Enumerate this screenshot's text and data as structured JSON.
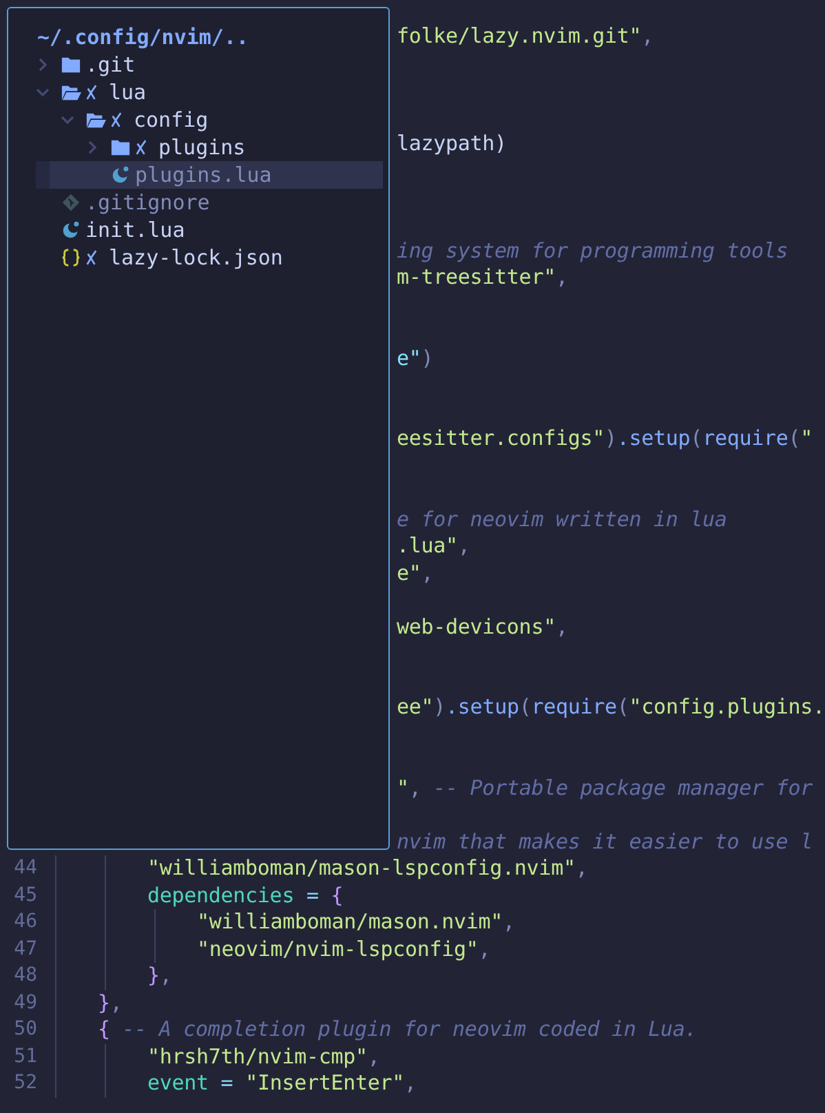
{
  "editor": {
    "rows": [
      {
        "kind": "partial",
        "segments": []
      },
      {
        "kind": "partial",
        "segments": [
          {
            "text": "folke/lazy.nvim.git\"",
            "kind": "str"
          },
          {
            "text": ",",
            "kind": "punct"
          }
        ]
      },
      {
        "kind": "partial",
        "segments": []
      },
      {
        "kind": "partial",
        "segments": []
      },
      {
        "kind": "partial",
        "segments": []
      },
      {
        "kind": "partial",
        "segments": [
          {
            "text": "lazypath)",
            "kind": "plain"
          }
        ]
      },
      {
        "kind": "partial",
        "segments": []
      },
      {
        "kind": "partial",
        "segments": []
      },
      {
        "kind": "partial",
        "segments": []
      },
      {
        "kind": "partial",
        "segments": [
          {
            "text": "ing system for programming tools",
            "kind": "comment"
          }
        ]
      },
      {
        "kind": "partial",
        "segments": [
          {
            "text": "m-treesitter\"",
            "kind": "str"
          },
          {
            "text": ",",
            "kind": "punct"
          }
        ]
      },
      {
        "kind": "partial",
        "segments": []
      },
      {
        "kind": "partial",
        "segments": []
      },
      {
        "kind": "partial",
        "segments": [
          {
            "text": "e\"",
            "kind": "cyan"
          },
          {
            "text": ")",
            "kind": "punct"
          }
        ]
      },
      {
        "kind": "partial",
        "segments": []
      },
      {
        "kind": "partial",
        "segments": []
      },
      {
        "kind": "partial",
        "segments": [
          {
            "text": "eesitter.configs\"",
            "kind": "str"
          },
          {
            "text": ")",
            "kind": "punct"
          },
          {
            "text": ".setup",
            "kind": "func"
          },
          {
            "text": "(",
            "kind": "punct"
          },
          {
            "text": "require",
            "kind": "func"
          },
          {
            "text": "(",
            "kind": "punct"
          },
          {
            "text": "\"",
            "kind": "str"
          }
        ]
      },
      {
        "kind": "partial",
        "segments": []
      },
      {
        "kind": "partial",
        "segments": []
      },
      {
        "kind": "partial",
        "segments": [
          {
            "text": "e for neovim written in lua",
            "kind": "comment"
          }
        ]
      },
      {
        "kind": "partial",
        "segments": [
          {
            "text": ".lua\"",
            "kind": "str"
          },
          {
            "text": ",",
            "kind": "punct"
          }
        ]
      },
      {
        "kind": "partial",
        "segments": [
          {
            "text": "e\"",
            "kind": "str"
          },
          {
            "text": ",",
            "kind": "punct"
          }
        ]
      },
      {
        "kind": "partial",
        "segments": []
      },
      {
        "kind": "partial",
        "segments": [
          {
            "text": "web-devicons\"",
            "kind": "str"
          },
          {
            "text": ",",
            "kind": "punct"
          }
        ]
      },
      {
        "kind": "partial",
        "segments": []
      },
      {
        "kind": "partial",
        "segments": []
      },
      {
        "kind": "partial",
        "segments": [
          {
            "text": "ee\"",
            "kind": "str"
          },
          {
            "text": ")",
            "kind": "punct"
          },
          {
            "text": ".setup",
            "kind": "func"
          },
          {
            "text": "(",
            "kind": "punct"
          },
          {
            "text": "require",
            "kind": "func"
          },
          {
            "text": "(",
            "kind": "punct"
          },
          {
            "text": "\"config.plugins.",
            "kind": "str"
          }
        ]
      },
      {
        "kind": "partial",
        "segments": []
      },
      {
        "kind": "partial",
        "segments": []
      },
      {
        "kind": "partial",
        "segments": [
          {
            "text": "\"",
            "kind": "str"
          },
          {
            "text": ", ",
            "kind": "punct"
          },
          {
            "text": "-- Portable package manager for",
            "kind": "comment"
          }
        ]
      },
      {
        "kind": "partial",
        "segments": []
      },
      {
        "kind": "partial",
        "segments": [
          {
            "text": "nvim that makes it easier to use l",
            "kind": "comment"
          }
        ]
      },
      {
        "kind": "full",
        "number": "44",
        "segments": [
          {
            "text": "        \"williamboman/mason-lspconfig.nvim\"",
            "kind": "str"
          },
          {
            "text": ",",
            "kind": "punct"
          }
        ]
      },
      {
        "kind": "full",
        "number": "45",
        "segments": [
          {
            "text": "        dependencies",
            "kind": "key"
          },
          {
            "text": " = ",
            "kind": "op"
          },
          {
            "text": "{",
            "kind": "brace"
          }
        ]
      },
      {
        "kind": "full",
        "number": "46",
        "segments": [
          {
            "text": "            \"williamboman/mason.nvim\"",
            "kind": "str"
          },
          {
            "text": ",",
            "kind": "punct"
          }
        ]
      },
      {
        "kind": "full",
        "number": "47",
        "segments": [
          {
            "text": "            \"neovim/nvim-lspconfig\"",
            "kind": "str"
          },
          {
            "text": ",",
            "kind": "punct"
          }
        ]
      },
      {
        "kind": "full",
        "number": "48",
        "segments": [
          {
            "text": "        }",
            "kind": "brace"
          },
          {
            "text": ",",
            "kind": "punct"
          }
        ]
      },
      {
        "kind": "full",
        "number": "49",
        "segments": [
          {
            "text": "    }",
            "kind": "brace"
          },
          {
            "text": ",",
            "kind": "punct"
          }
        ]
      },
      {
        "kind": "full",
        "number": "50",
        "segments": [
          {
            "text": "    {",
            "kind": "brace"
          },
          {
            "text": " -- A completion plugin for neovim coded in Lua.",
            "kind": "comment"
          }
        ]
      },
      {
        "kind": "full",
        "number": "51",
        "segments": [
          {
            "text": "        \"hrsh7th/nvim-cmp\"",
            "kind": "str"
          },
          {
            "text": ",",
            "kind": "punct"
          }
        ]
      },
      {
        "kind": "full",
        "number": "52",
        "segments": [
          {
            "text": "        event",
            "kind": "key"
          },
          {
            "text": " = ",
            "kind": "op"
          },
          {
            "text": "\"InsertEnter\"",
            "kind": "str"
          },
          {
            "text": ",",
            "kind": "punct"
          }
        ]
      }
    ]
  },
  "file_tree": {
    "title": "~/.config/nvim/..",
    "items": [
      {
        "name": ".git",
        "kind": "folder",
        "expanded": false,
        "modified": false,
        "dim": false,
        "selected": false
      },
      {
        "name": "lua",
        "kind": "folder",
        "expanded": true,
        "modified": true,
        "dim": false,
        "selected": false,
        "children": [
          {
            "name": "config",
            "kind": "folder",
            "expanded": true,
            "modified": true,
            "dim": false,
            "selected": false,
            "children": [
              {
                "name": "plugins",
                "kind": "folder",
                "expanded": false,
                "modified": true,
                "dim": false,
                "selected": false
              },
              {
                "name": "plugins.lua",
                "kind": "lua",
                "modified": false,
                "dim": true,
                "selected": true
              }
            ]
          }
        ]
      },
      {
        "name": ".gitignore",
        "kind": "git",
        "modified": false,
        "dim": true,
        "selected": false
      },
      {
        "name": "init.lua",
        "kind": "lua",
        "modified": false,
        "dim": false,
        "selected": false
      },
      {
        "name": "lazy-lock.json",
        "kind": "json",
        "modified": true,
        "dim": false,
        "selected": false
      }
    ]
  }
}
